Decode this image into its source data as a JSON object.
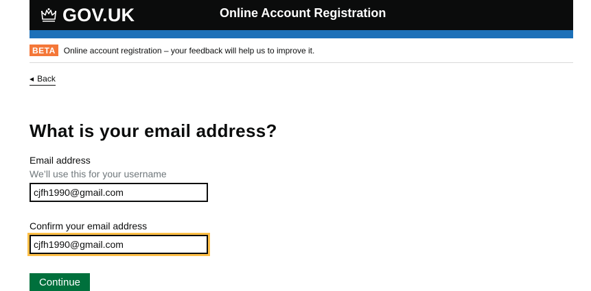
{
  "header": {
    "logo_text": "GOV.UK",
    "service_name": "Online Account Registration"
  },
  "phase_banner": {
    "tag": "BETA",
    "text": "Online account registration – your feedback will help us to improve it."
  },
  "back_link": {
    "label": "Back"
  },
  "page": {
    "title": "What is your email address?"
  },
  "form": {
    "email": {
      "label": "Email address",
      "hint": "We’ll use this for your username",
      "value": "cjfh1990@gmail.com"
    },
    "confirm_email": {
      "label": "Confirm your email address",
      "value": "cjfh1990@gmail.com"
    },
    "continue_label": "Continue"
  },
  "colors": {
    "header_bg": "#0b0c0c",
    "header_stripe": "#1d70b8",
    "beta_tag": "#f47738",
    "focus": "#ffbf47",
    "button": "#00703c"
  },
  "icons": {
    "logo": "crown-icon",
    "back": "back-arrow-icon"
  }
}
